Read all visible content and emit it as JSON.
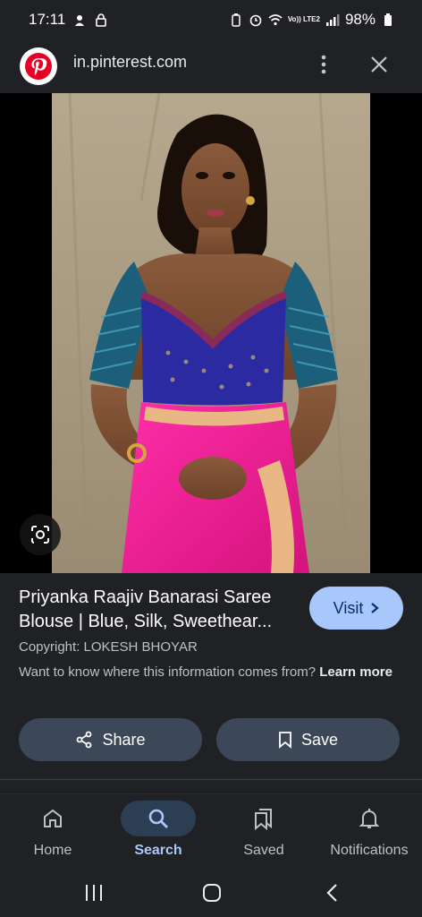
{
  "status_bar": {
    "time": "17:11",
    "network": "Vo)) LTE2",
    "battery": "98%"
  },
  "url_bar": {
    "site_icon": "pinterest-logo",
    "url": "in.pinterest.com"
  },
  "pin": {
    "title": "Priyanka Raajiv Banarasi Saree Blouse | Blue, Silk, Sweethear...",
    "visit_label": "Visit",
    "copyright": "Copyright: LOKESH BHOYAR",
    "info_question": "Want to know where this information comes from?",
    "learn_more": "Learn more",
    "share_label": "Share",
    "save_label": "Save"
  },
  "bottom_nav": {
    "items": [
      {
        "label": "Home",
        "icon": "home-icon",
        "active": false
      },
      {
        "label": "Search",
        "icon": "search-icon",
        "active": true
      },
      {
        "label": "Saved",
        "icon": "bookmarks-icon",
        "active": false
      },
      {
        "label": "Notifications",
        "icon": "bell-icon",
        "active": false
      }
    ]
  },
  "colors": {
    "background": "#202124",
    "accent": "#a8c7fa",
    "button_bg": "#3c4858",
    "pinterest_red": "#e60023"
  }
}
